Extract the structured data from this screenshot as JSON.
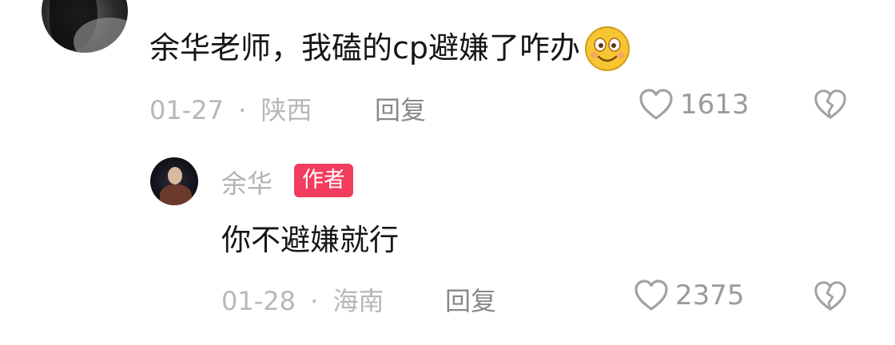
{
  "comment": {
    "text": "余华老师，我磕的cp避嫌了咋办",
    "emoji": "smile-emoji",
    "date": "01-27",
    "separator": "·",
    "location": "陕西",
    "reply_label": "回复",
    "likes": "1613"
  },
  "reply": {
    "author_name": "余华",
    "author_badge": "作者",
    "text": "你不避嫌就行",
    "date": "01-28",
    "separator": "·",
    "location": "海南",
    "reply_label": "回复",
    "likes": "2375"
  },
  "colors": {
    "badge": "#f23d5e",
    "text_primary": "#161616",
    "text_meta": "#b7b7b7",
    "emoji_yellow": "#f7c531"
  },
  "icons": [
    "heart-outline-icon",
    "broken-heart-icon"
  ]
}
